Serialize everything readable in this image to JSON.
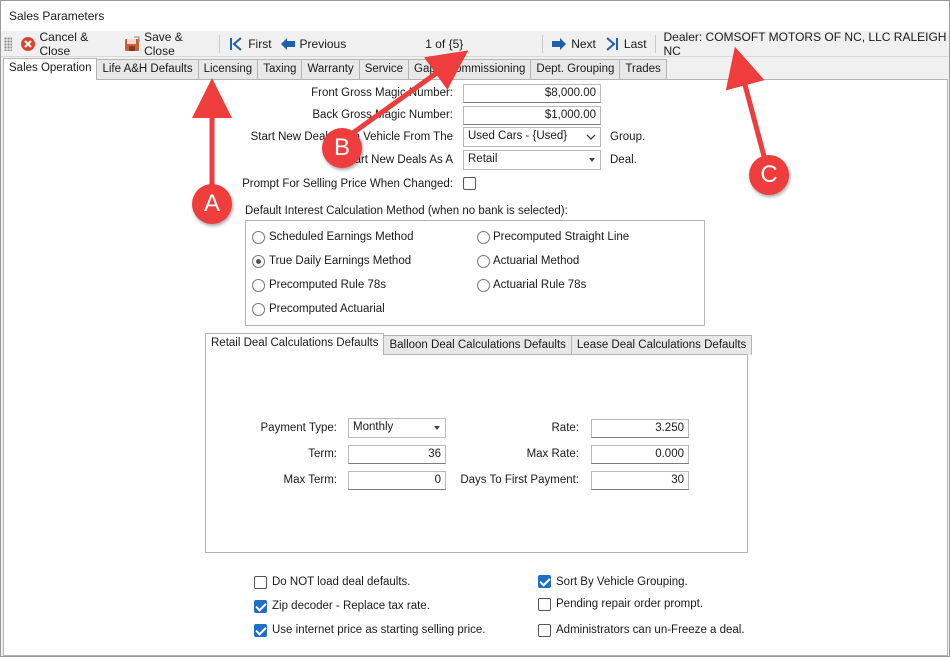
{
  "window": {
    "title": "Sales Parameters"
  },
  "toolbar": {
    "cancel_close": "Cancel & Close",
    "save_close": "Save & Close",
    "first": "First",
    "previous": "Previous",
    "record": "1 of {5}",
    "next": "Next",
    "last": "Last",
    "dealer": "Dealer: COMSOFT MOTORS OF NC, LLC RALEIGH NC"
  },
  "tabs": [
    "Sales Operation",
    "Life A&H Defaults",
    "Licensing",
    "Taxing",
    "Warranty",
    "Service",
    "Gap",
    "Commissioning",
    "Dept. Grouping",
    "Trades"
  ],
  "form": {
    "front_gross_label": "Front Gross Magic Number:",
    "front_gross_value": "$8,000.00",
    "back_gross_label": "Back Gross Magic Number:",
    "back_gross_value": "$1,000.00",
    "start_vehicle_label": "Start New Deals With Vehicle From The",
    "start_vehicle_value": "Used Cars - {Used}",
    "group_suffix": "Group.",
    "start_deals_label": "Start New Deals As A",
    "start_deals_value": "Retail",
    "deal_suffix": "Deal.",
    "prompt_selling_label": "Prompt For Selling Price When Changed:",
    "interest_group_label": "Default Interest Calculation Method (when no bank is selected):"
  },
  "interest_methods": [
    {
      "label": "Scheduled Earnings Method",
      "selected": false
    },
    {
      "label": "Precomputed Straight Line",
      "selected": false
    },
    {
      "label": "True Daily Earnings Method",
      "selected": true
    },
    {
      "label": "Actuarial Method",
      "selected": false
    },
    {
      "label": "Precomputed Rule 78s",
      "selected": false
    },
    {
      "label": "Actuarial Rule 78s",
      "selected": false
    },
    {
      "label": "Precomputed Actuarial",
      "selected": false
    }
  ],
  "sub_tabs": [
    "Retail Deal Calculations Defaults",
    "Balloon Deal Calculations Defaults",
    "Lease Deal Calculations Defaults"
  ],
  "retail": {
    "payment_type_label": "Payment Type:",
    "payment_type_value": "Monthly",
    "term_label": "Term:",
    "term_value": "36",
    "max_term_label": "Max Term:",
    "max_term_value": "0",
    "rate_label": "Rate:",
    "rate_value": "3.250",
    "max_rate_label": "Max Rate:",
    "max_rate_value": "0.000",
    "days_first_label": "Days To First Payment:",
    "days_first_value": "30"
  },
  "options": [
    {
      "label": "Do NOT load deal defaults.",
      "checked": false
    },
    {
      "label": "Sort By Vehicle Grouping.",
      "checked": true
    },
    {
      "label": "Zip decoder - Replace tax rate.",
      "checked": true
    },
    {
      "label": "Pending repair order prompt.",
      "checked": false
    },
    {
      "label": "Use internet price as starting selling price.",
      "checked": true
    },
    {
      "label": "Administrators can un-Freeze a deal.",
      "checked": false
    }
  ],
  "annotations": {
    "a": "A",
    "b": "B",
    "c": "C",
    "color": "#ef3d3d"
  },
  "colors": {
    "accent": "#1f6fc5",
    "nav_arrow": "#1f5fae",
    "cancel": "#d9442f"
  }
}
